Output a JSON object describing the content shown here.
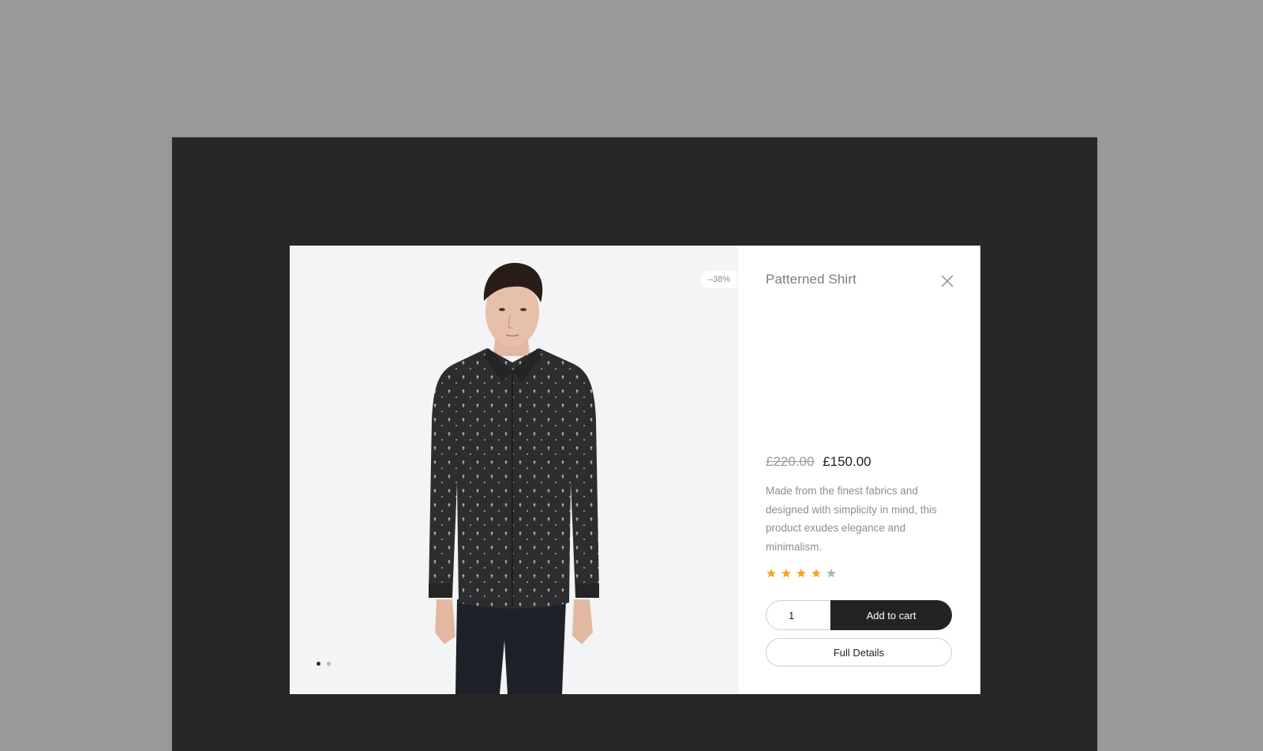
{
  "product": {
    "discount_badge": "–38%",
    "title": "Patterned Shirt",
    "old_price": "£220.00",
    "new_price": "£150.00",
    "description": "Made from the finest fabrics and designed with simplicity in mind, this product exudes elegance and minimalism.",
    "rating": 4,
    "rating_max": 5,
    "image_icon": "model-wearing-patterned-shirt",
    "gallery_count": 2,
    "gallery_active": 0
  },
  "cart": {
    "quantity": "1",
    "add_label": "Add to cart",
    "details_label": "Full Details"
  },
  "colors": {
    "star_filled": "#f5a623",
    "star_empty": "#b3b3b3",
    "button_dark": "#232323",
    "backdrop": "#272727",
    "page_bg": "#9a9a9a"
  },
  "icons": {
    "close": "close-icon"
  }
}
